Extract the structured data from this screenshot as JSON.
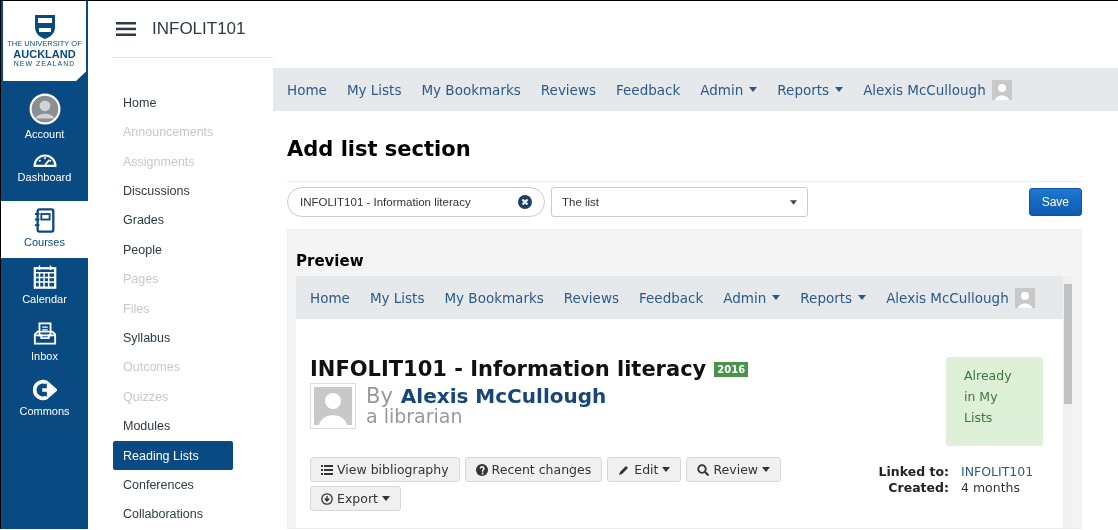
{
  "global_nav": {
    "logo": [
      "THE UNIVERSITY OF",
      "AUCKLAND",
      "NEW ZEALAND"
    ],
    "items": [
      {
        "label": "Account",
        "selected": false
      },
      {
        "label": "Dashboard",
        "selected": false
      },
      {
        "label": "Courses",
        "selected": true
      },
      {
        "label": "Calendar",
        "selected": false
      },
      {
        "label": "Inbox",
        "selected": false
      },
      {
        "label": "Commons",
        "selected": false
      }
    ]
  },
  "course_title": "INFOLIT101",
  "course_nav": [
    {
      "label": "Home",
      "disabled": false,
      "selected": false
    },
    {
      "label": "Announcements",
      "disabled": true,
      "selected": false
    },
    {
      "label": "Assignments",
      "disabled": true,
      "selected": false
    },
    {
      "label": "Discussions",
      "disabled": false,
      "selected": false
    },
    {
      "label": "Grades",
      "disabled": false,
      "selected": false
    },
    {
      "label": "People",
      "disabled": false,
      "selected": false
    },
    {
      "label": "Pages",
      "disabled": true,
      "selected": false
    },
    {
      "label": "Files",
      "disabled": true,
      "selected": false
    },
    {
      "label": "Syllabus",
      "disabled": false,
      "selected": false
    },
    {
      "label": "Outcomes",
      "disabled": true,
      "selected": false
    },
    {
      "label": "Quizzes",
      "disabled": true,
      "selected": false
    },
    {
      "label": "Modules",
      "disabled": false,
      "selected": false
    },
    {
      "label": "Reading Lists",
      "disabled": false,
      "selected": true
    },
    {
      "label": "Conferences",
      "disabled": false,
      "selected": false
    },
    {
      "label": "Collaborations",
      "disabled": false,
      "selected": false
    }
  ],
  "top_nav": {
    "items": [
      {
        "label": "Home",
        "dropdown": false
      },
      {
        "label": "My Lists",
        "dropdown": false
      },
      {
        "label": "My Bookmarks",
        "dropdown": false
      },
      {
        "label": "Reviews",
        "dropdown": false
      },
      {
        "label": "Feedback",
        "dropdown": false
      },
      {
        "label": "Admin",
        "dropdown": true
      },
      {
        "label": "Reports",
        "dropdown": true
      }
    ],
    "user": "Alexis McCullough"
  },
  "page_title": "Add list section",
  "form": {
    "course_field": "INFOLIT101 - Information literacy",
    "list_select": "The list",
    "save": "Save"
  },
  "preview": {
    "title": "Preview",
    "nav": {
      "items": [
        {
          "label": "Home",
          "dropdown": false
        },
        {
          "label": "My Lists",
          "dropdown": false
        },
        {
          "label": "My Bookmarks",
          "dropdown": false
        },
        {
          "label": "Reviews",
          "dropdown": false
        },
        {
          "label": "Feedback",
          "dropdown": false
        },
        {
          "label": "Admin",
          "dropdown": true
        },
        {
          "label": "Reports",
          "dropdown": true
        }
      ],
      "user": "Alexis McCullough"
    },
    "list": {
      "title": "INFOLIT101 - Information literacy",
      "badge": "2016",
      "by": "By",
      "author": "Alexis McCullough",
      "role": "a librarian",
      "status": "Already in My Lists",
      "buttons": [
        {
          "label": "View bibliography",
          "dropdown": false
        },
        {
          "label": "Recent changes",
          "dropdown": false
        },
        {
          "label": "Edit",
          "dropdown": true
        },
        {
          "label": "Review",
          "dropdown": true
        },
        {
          "label": "Export",
          "dropdown": true
        }
      ],
      "meta": [
        {
          "label": "Linked to:",
          "value": "INFOLIT101",
          "link": true
        },
        {
          "label": "Created:",
          "value": "4 months",
          "link": false
        }
      ]
    }
  }
}
